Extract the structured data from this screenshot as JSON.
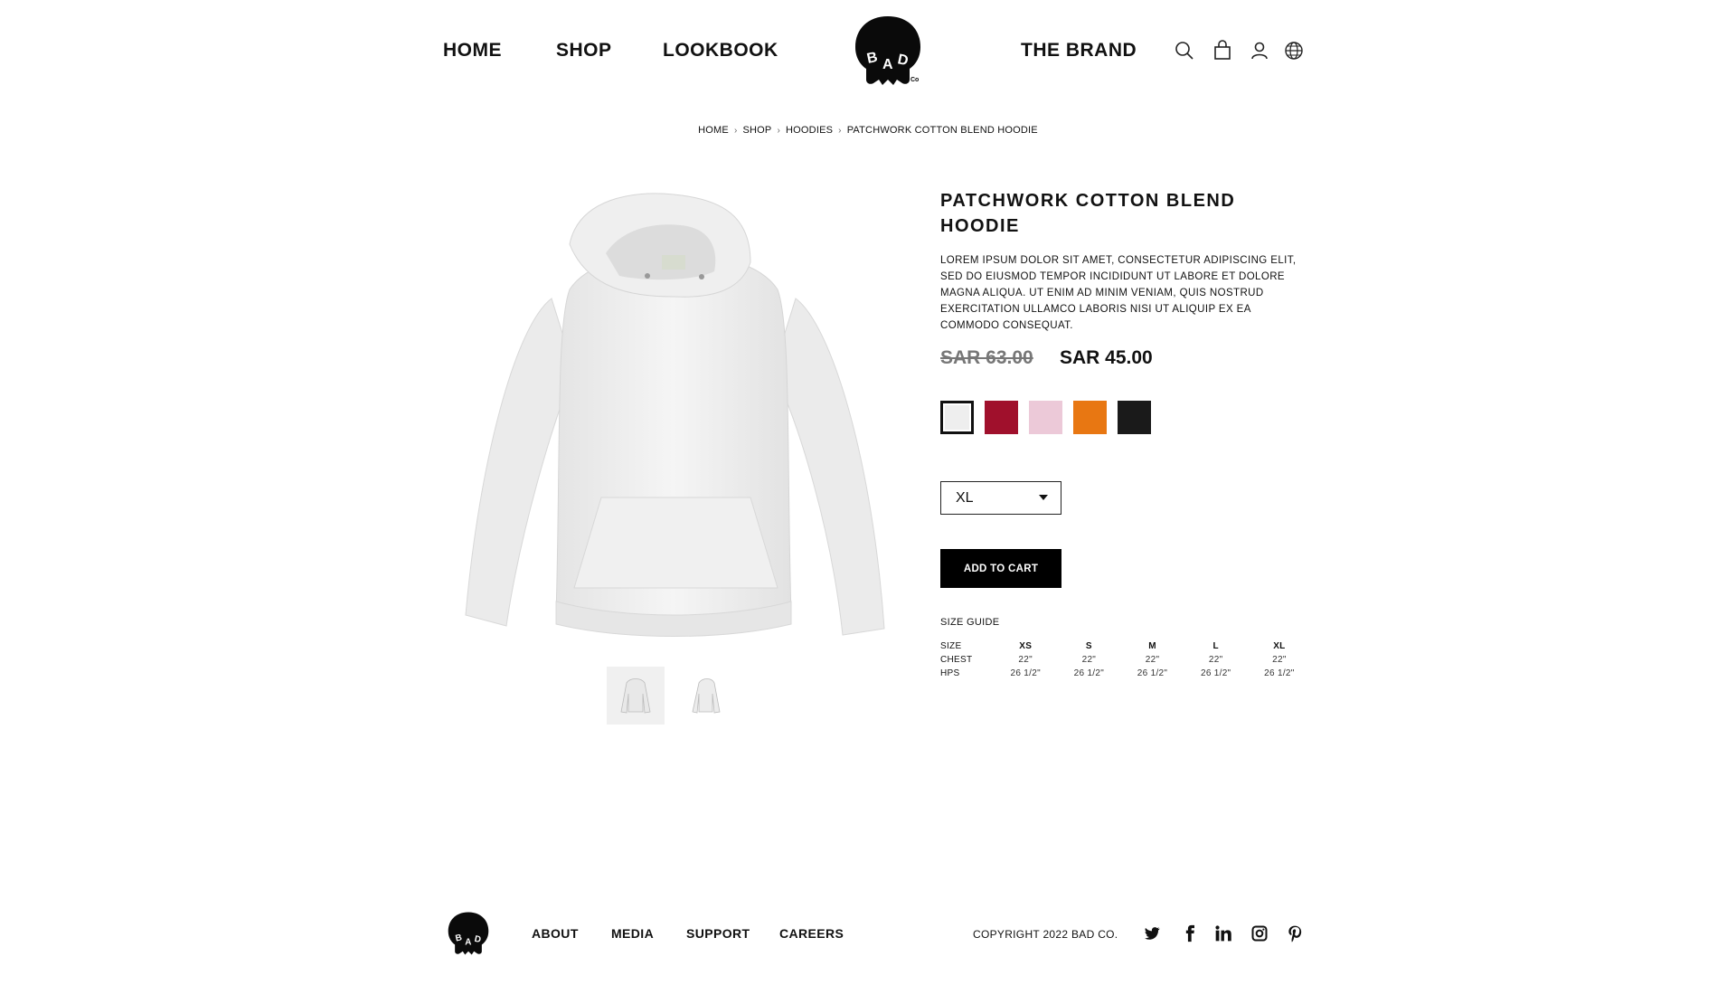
{
  "header": {
    "nav": [
      {
        "label": "HOME"
      },
      {
        "label": "SHOP"
      },
      {
        "label": "LOOKBOOK"
      },
      {
        "label": "THE BRAND"
      }
    ],
    "logo_text": "BAD Co.",
    "icons": [
      "search-icon",
      "shopping-bag-icon",
      "user-icon",
      "globe-icon"
    ]
  },
  "breadcrumb": [
    "HOME",
    "SHOP",
    "HOODIES",
    "PATCHWORK COTTON BLEND HOODIE"
  ],
  "product": {
    "title": "PATCHWORK COTTON BLEND HOODIE",
    "description": "LOREM IPSUM DOLOR SIT AMET, CONSECTETUR ADIPISCING ELIT, SED DO EIUSMOD TEMPOR INCIDIDUNT UT LABORE ET DOLORE MAGNA ALIQUA. UT ENIM AD MINIM VENIAM, QUIS NOSTRUD EXERCITATION ULLAMCO LABORIS NISI UT ALIQUIP EX EA COMMODO CONSEQUAT.",
    "price_old": "SAR 63.00",
    "price_new": "SAR 45.00",
    "colors": [
      {
        "hex": "#eeeeee",
        "selected": true
      },
      {
        "hex": "#a0102c",
        "selected": false
      },
      {
        "hex": "#ecc9d8",
        "selected": false
      },
      {
        "hex": "#e87712",
        "selected": false
      },
      {
        "hex": "#1a1a1a",
        "selected": false
      }
    ],
    "size_selected": "XL",
    "add_to_cart_label": "ADD TO CART"
  },
  "size_guide": {
    "title": "SIZE GUIDE",
    "header": [
      "SIZE",
      "XS",
      "S",
      "M",
      "L",
      "XL"
    ],
    "rows": [
      [
        "CHEST",
        "22\"",
        "22\"",
        "22\"",
        "22\"",
        "22\""
      ],
      [
        "HPS",
        "26 1/2\"",
        "26 1/2\"",
        "26 1/2\"",
        "26 1/2\"",
        "26 1/2\""
      ]
    ]
  },
  "footer": {
    "links": [
      {
        "label": "ABOUT"
      },
      {
        "label": "MEDIA"
      },
      {
        "label": "SUPPORT"
      },
      {
        "label": "CAREERS"
      }
    ],
    "copyright": "COPYRIGHT 2022 BAD CO.",
    "social": [
      "twitter-icon",
      "facebook-icon",
      "linkedin-icon",
      "instagram-icon",
      "pinterest-icon"
    ]
  }
}
